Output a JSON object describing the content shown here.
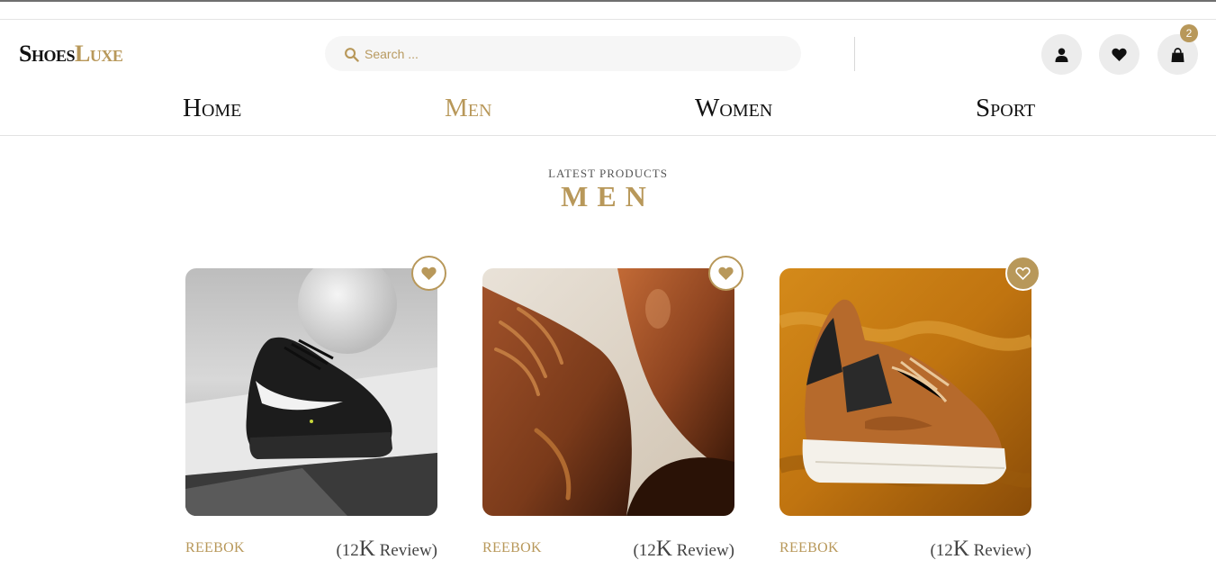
{
  "brand": {
    "name_main": "Shoes",
    "name_accent": "Luxe"
  },
  "search": {
    "placeholder": "Search ..."
  },
  "cart": {
    "count": "2"
  },
  "colors": {
    "accent": "#b8985a",
    "icon_bg": "#ececec",
    "search_bg": "#f6f6f6"
  },
  "icons": {
    "search": "search-icon",
    "user": "user-icon",
    "wishlist": "heart-icon",
    "cart": "bag-icon"
  },
  "nav": [
    {
      "label": "Home",
      "active": false
    },
    {
      "label": "Men",
      "active": true
    },
    {
      "label": "Women",
      "active": false
    },
    {
      "label": "Sport",
      "active": false
    }
  ],
  "section": {
    "kicker": "LATEST PRODUCTS",
    "title": "MEN"
  },
  "products": [
    {
      "brand": "REEBOK",
      "reviews_open": "(12",
      "reviews_big": "K",
      "reviews_close": " Review)",
      "favorite": false
    },
    {
      "brand": "REEBOK",
      "reviews_open": "(12",
      "reviews_big": "K",
      "reviews_close": " Review)",
      "favorite": false
    },
    {
      "brand": "REEBOK",
      "reviews_open": "(12",
      "reviews_big": "K",
      "reviews_close": " Review)",
      "favorite": true
    }
  ]
}
